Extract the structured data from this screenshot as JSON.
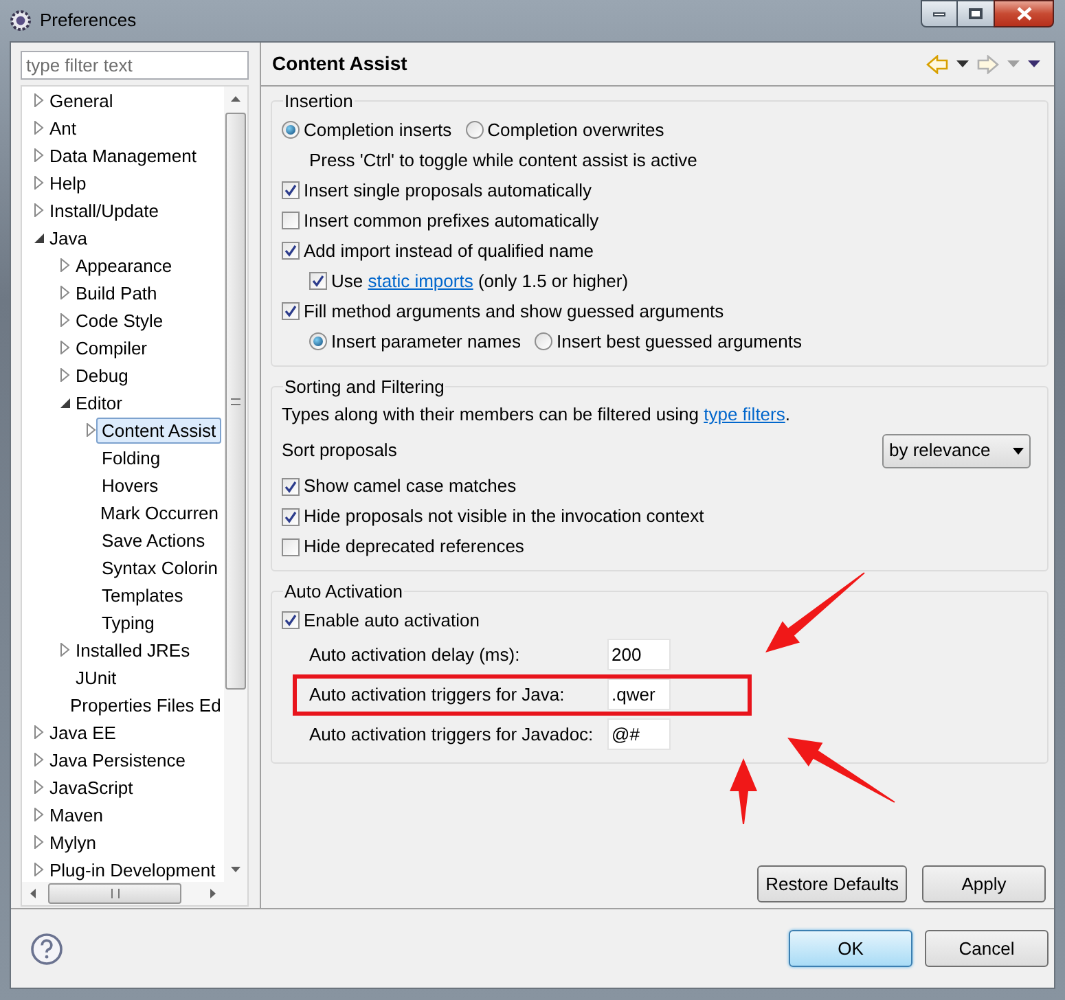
{
  "window": {
    "title": "Preferences"
  },
  "filter": {
    "placeholder": "type filter text"
  },
  "tree": [
    {
      "label": "General",
      "expandable": true,
      "expanded": false,
      "selected": false
    },
    {
      "label": "Ant",
      "expandable": true,
      "expanded": false,
      "selected": false
    },
    {
      "label": "Data Management",
      "expandable": true,
      "expanded": false,
      "selected": false
    },
    {
      "label": "Help",
      "expandable": true,
      "expanded": false,
      "selected": false
    },
    {
      "label": "Install/Update",
      "expandable": true,
      "expanded": false,
      "selected": false
    },
    {
      "label": "Java",
      "expandable": true,
      "expanded": true,
      "selected": false,
      "children": [
        {
          "label": "Appearance",
          "expandable": true,
          "expanded": false,
          "selected": false
        },
        {
          "label": "Build Path",
          "expandable": true,
          "expanded": false,
          "selected": false
        },
        {
          "label": "Code Style",
          "expandable": true,
          "expanded": false,
          "selected": false
        },
        {
          "label": "Compiler",
          "expandable": true,
          "expanded": false,
          "selected": false
        },
        {
          "label": "Debug",
          "expandable": true,
          "expanded": false,
          "selected": false
        },
        {
          "label": "Editor",
          "expandable": true,
          "expanded": true,
          "selected": false,
          "children": [
            {
              "label": "Content Assist",
              "expandable": true,
              "expanded": false,
              "selected": true
            },
            {
              "label": "Folding",
              "expandable": false,
              "selected": false
            },
            {
              "label": "Hovers",
              "expandable": false,
              "selected": false
            },
            {
              "label": "Mark Occurren",
              "expandable": false,
              "selected": false
            },
            {
              "label": "Save Actions",
              "expandable": false,
              "selected": false
            },
            {
              "label": "Syntax Colorin",
              "expandable": false,
              "selected": false
            },
            {
              "label": "Templates",
              "expandable": false,
              "selected": false
            },
            {
              "label": "Typing",
              "expandable": false,
              "selected": false
            }
          ]
        },
        {
          "label": "Installed JREs",
          "expandable": true,
          "expanded": false,
          "selected": false
        },
        {
          "label": "JUnit",
          "expandable": false,
          "selected": false
        },
        {
          "label": "Properties Files Ed",
          "expandable": false,
          "selected": false
        }
      ]
    },
    {
      "label": "Java EE",
      "expandable": true,
      "expanded": false,
      "selected": false
    },
    {
      "label": "Java Persistence",
      "expandable": true,
      "expanded": false,
      "selected": false
    },
    {
      "label": "JavaScript",
      "expandable": true,
      "expanded": false,
      "selected": false
    },
    {
      "label": "Maven",
      "expandable": true,
      "expanded": false,
      "selected": false
    },
    {
      "label": "Mylyn",
      "expandable": true,
      "expanded": false,
      "selected": false
    },
    {
      "label": "Plug-in Development",
      "expandable": true,
      "expanded": false,
      "selected": false
    }
  ],
  "page": {
    "title": "Content Assist"
  },
  "groups": [
    {
      "title": "Insertion",
      "rows": [
        {
          "kind": "radios",
          "options": [
            {
              "label": "Completion inserts",
              "selected": true
            },
            {
              "label": "Completion overwrites",
              "selected": false
            }
          ]
        },
        {
          "kind": "note",
          "text": "Press 'Ctrl' to toggle while content assist is active"
        },
        {
          "kind": "checkbox",
          "label": "Insert single proposals automatically",
          "checked": true
        },
        {
          "kind": "checkbox",
          "label": "Insert common prefixes automatically",
          "checked": false
        },
        {
          "kind": "checkbox",
          "label": "Add import instead of qualified name",
          "checked": true,
          "children": [
            {
              "kind": "checkbox",
              "label": "Use",
              "link": "static imports",
              "after": "(only 1.5 or higher)",
              "checked": true
            }
          ]
        },
        {
          "kind": "checkbox",
          "label": "Fill method arguments and show guessed arguments",
          "checked": true,
          "children": [
            {
              "kind": "radios",
              "options": [
                {
                  "label": "Insert parameter names",
                  "selected": true
                },
                {
                  "label": "Insert best guessed arguments",
                  "selected": false
                }
              ]
            }
          ]
        }
      ]
    },
    {
      "title": "Sorting and Filtering",
      "rows": [
        {
          "kind": "linknote",
          "text": "Types along with their members can be filtered using",
          "link": "type filters",
          "after": "."
        },
        {
          "kind": "select",
          "label": "Sort proposals",
          "value": "by relevance"
        },
        {
          "kind": "checkbox",
          "label": "Show camel case matches",
          "checked": true
        },
        {
          "kind": "checkbox",
          "label": "Hide proposals not visible in the invocation context",
          "checked": true
        },
        {
          "kind": "checkbox",
          "label": "Hide deprecated references",
          "checked": false
        }
      ]
    },
    {
      "title": "Auto Activation",
      "rows": [
        {
          "kind": "checkbox",
          "label": "Enable auto activation",
          "checked": true
        },
        {
          "kind": "field",
          "label": "Auto activation delay (ms):",
          "value": "200",
          "highlighted": false
        },
        {
          "kind": "field",
          "label": "Auto activation triggers for Java:",
          "value": ".qwer",
          "highlighted": true
        },
        {
          "kind": "field",
          "label": "Auto activation triggers for Javadoc:",
          "value": "@#",
          "highlighted": false
        }
      ]
    }
  ],
  "page_buttons": [
    "Restore Defaults",
    "Apply"
  ],
  "dialog_buttons": [
    {
      "label": "OK",
      "default": true
    },
    {
      "label": "Cancel",
      "default": false
    }
  ]
}
